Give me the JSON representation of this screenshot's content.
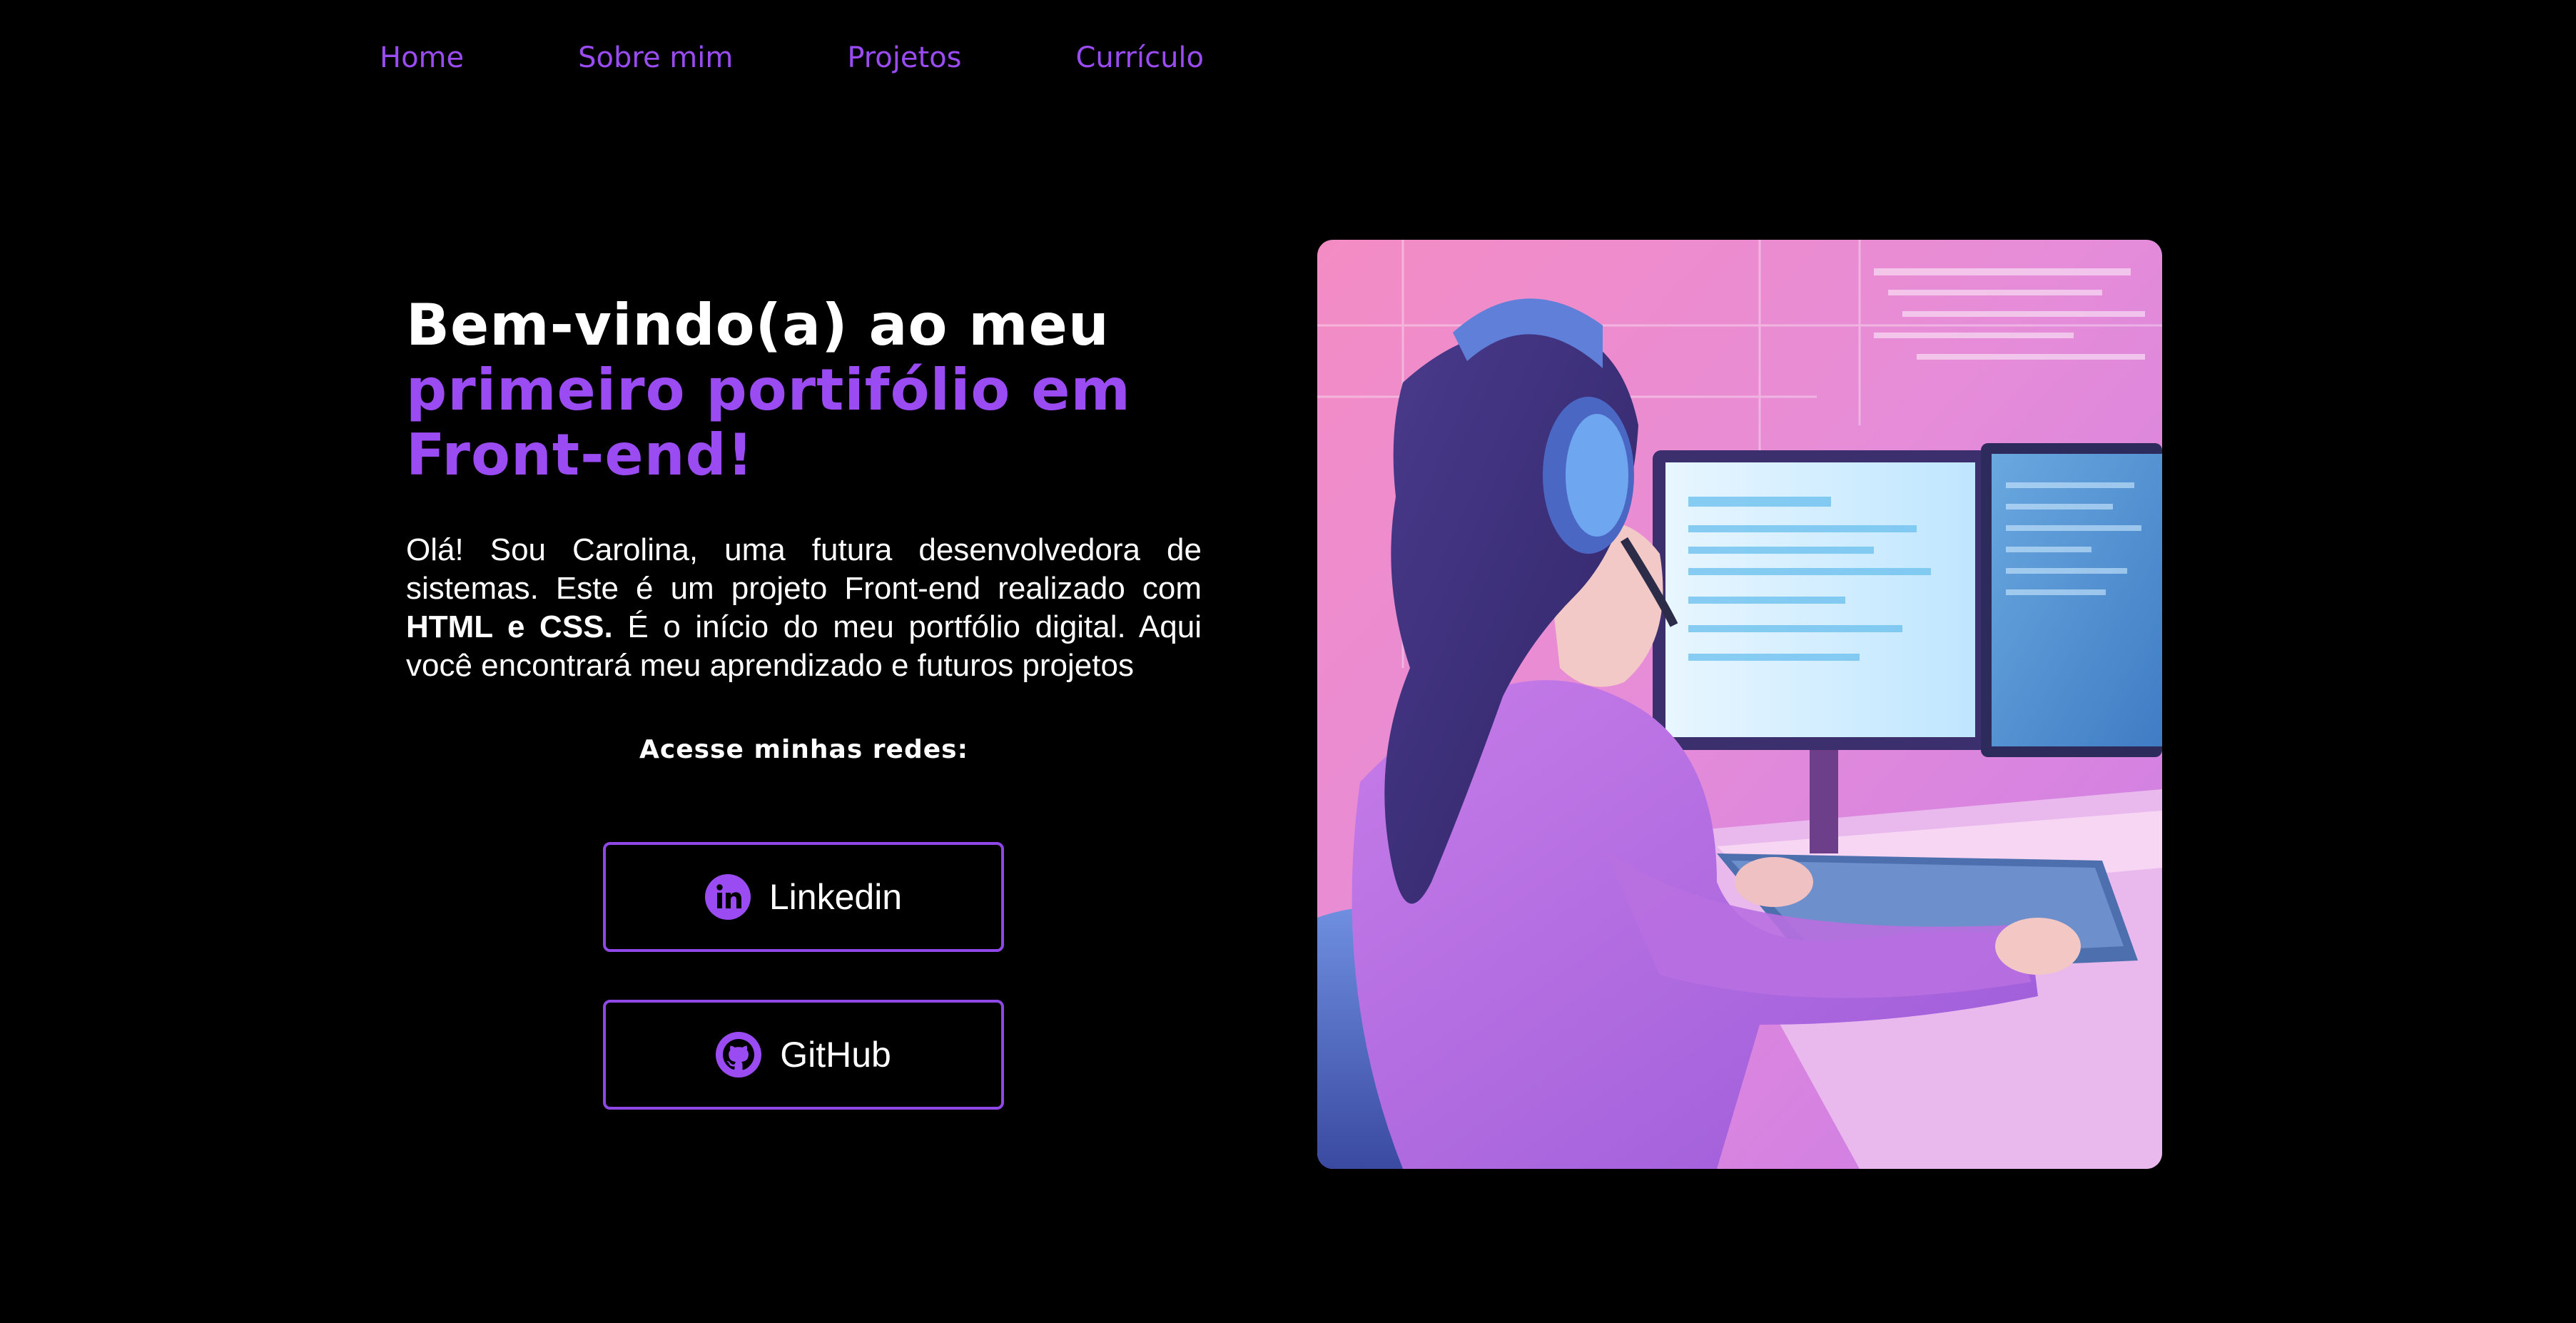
{
  "nav": {
    "items": [
      {
        "label": "Home"
      },
      {
        "label": "Sobre mim"
      },
      {
        "label": "Projetos"
      },
      {
        "label": "Currículo"
      }
    ]
  },
  "hero": {
    "title_line1": "Bem-vindo(a) ao meu",
    "title_line2": "primeiro portifólio em",
    "title_line3": "Front-end!",
    "intro_part1": "Olá! Sou Carolina, uma futura desenvolvedora de sistemas. Este é um projeto Front-end realizado com ",
    "intro_bold": "HTML e CSS.",
    "intro_part2": " É o início do meu portfólio digital. Aqui você encontrará meu aprendizado e futuros projetos"
  },
  "social": {
    "heading": "Acesse minhas redes:",
    "linkedin_label": "Linkedin",
    "github_label": "GitHub",
    "linkedin_icon": "linkedin-icon",
    "github_icon": "github-icon"
  },
  "colors": {
    "accent": "#9a4bf2",
    "background": "#000000",
    "text": "#ffffff"
  },
  "image": {
    "subject": "illustration-girl-with-headphones-at-computer"
  }
}
